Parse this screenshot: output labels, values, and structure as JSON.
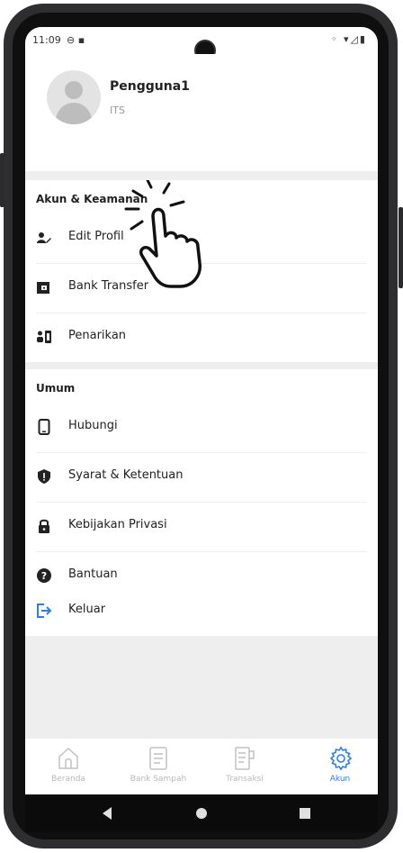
{
  "status_bar": {
    "time": "11:09",
    "indicators": "⊖ ▪"
  },
  "profile": {
    "name": "Pengguna1",
    "org": "ITS"
  },
  "account_section": {
    "title": "Akun & Keamanan",
    "items": [
      {
        "label": "Edit Profil",
        "icon": "edit-profile-icon"
      },
      {
        "label": "Bank Transfer",
        "icon": "bank-transfer-icon"
      },
      {
        "label": "Penarikan",
        "icon": "withdrawal-icon"
      }
    ]
  },
  "general_section": {
    "title": "Umum",
    "items": [
      {
        "label": "Hubungi",
        "icon": "phone-icon"
      },
      {
        "label": "Syarat & Ketentuan",
        "icon": "shield-icon"
      },
      {
        "label": "Kebijakan Privasi",
        "icon": "lock-icon"
      },
      {
        "label": "Bantuan",
        "icon": "help-icon"
      }
    ]
  },
  "logout": {
    "label": "Keluar",
    "icon": "logout-icon",
    "color": "#2f7ee8"
  },
  "bottom_nav": {
    "tabs": [
      {
        "label": "Beranda",
        "icon": "home-icon",
        "active": false
      },
      {
        "label": "Bank Sampah",
        "icon": "document-icon",
        "active": false
      },
      {
        "label": "Transaksi",
        "icon": "receipt-icon",
        "active": false
      },
      {
        "label": "Akun",
        "icon": "gear-icon",
        "active": true
      }
    ]
  },
  "colors": {
    "accent": "#2f7ee8",
    "background": "#eeeeee",
    "card": "#ffffff"
  }
}
